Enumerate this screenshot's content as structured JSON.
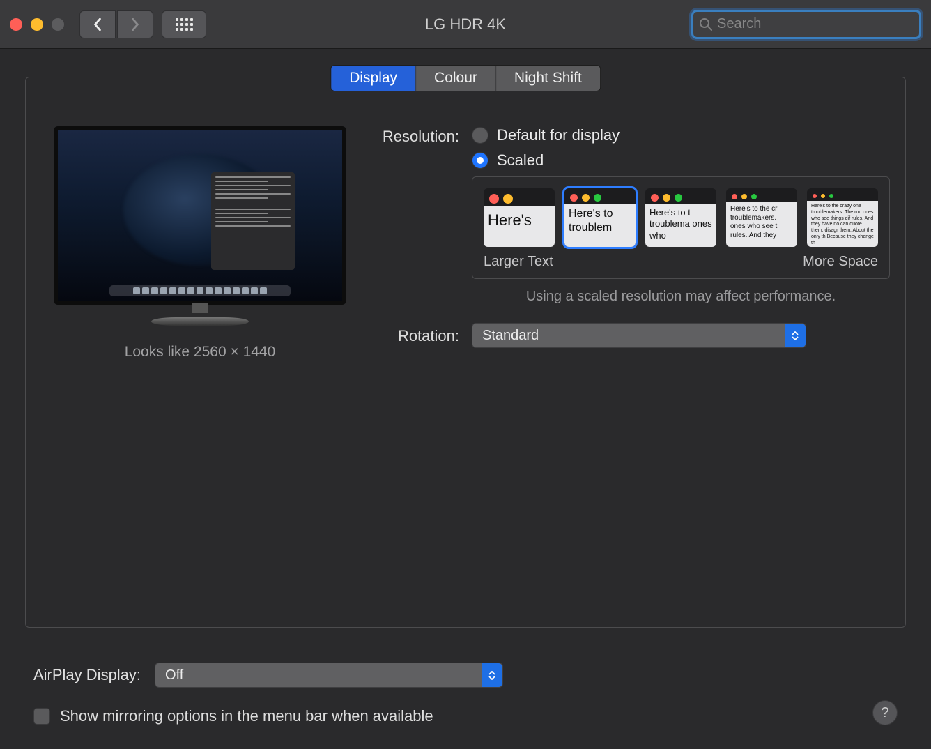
{
  "window": {
    "title": "LG HDR 4K",
    "search_placeholder": "Search"
  },
  "tabs": [
    "Display",
    "Colour",
    "Night Shift"
  ],
  "preview": {
    "looks_like": "Looks like 2560 × 1440"
  },
  "resolution": {
    "label": "Resolution:",
    "option_default": "Default for display",
    "option_scaled": "Scaled",
    "larger_text": "Larger Text",
    "more_space": "More Space",
    "note": "Using a scaled resolution may affect performance.",
    "thumbs": [
      "Here's",
      "Here's to troublem",
      "Here's to t troublema ones who",
      "Here's to the cr troublemakers. ones who see t rules. And they",
      "Here's to the crazy one troublemakers. The rou ones who see things dif rules. And they have no can quote them, disagr them. About the only th Because they change th"
    ]
  },
  "rotation": {
    "label": "Rotation:",
    "value": "Standard"
  },
  "airplay": {
    "label": "AirPlay Display:",
    "value": "Off"
  },
  "mirroring": {
    "label": "Show mirroring options in the menu bar when available"
  },
  "help": "?"
}
